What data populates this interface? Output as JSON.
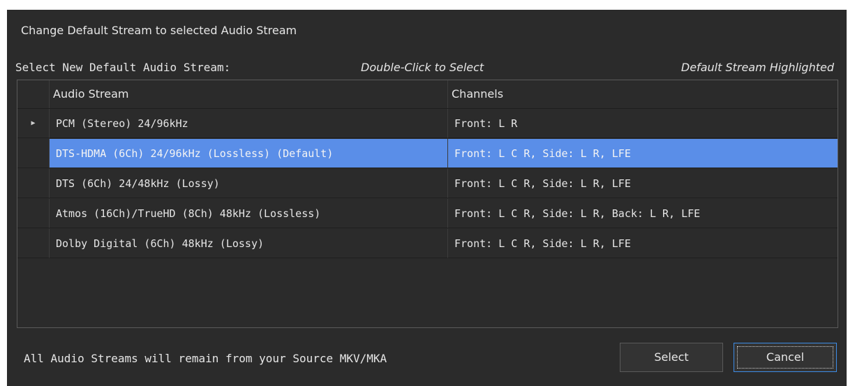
{
  "dialog": {
    "title": "Change Default Stream to selected Audio Stream",
    "select_label": "Select New Default Audio Stream:",
    "hint_double_click": "Double-Click to Select",
    "hint_default_highlighted": "Default Stream Highlighted",
    "footer_text": "All Audio Streams will remain from your Source MKV/MKA",
    "colors": {
      "background": "#2b2b2b",
      "selection": "#5a8ee8",
      "focus_border": "#3c8ce6",
      "text": "#e6e6e6"
    }
  },
  "grid": {
    "columns": [
      "Audio Stream",
      "Channels"
    ],
    "current_row_icon": "triangle-right-icon",
    "rows": [
      {
        "stream": "PCM (Stereo) 24/96kHz",
        "channels": "Front: L R",
        "current": true,
        "selected": false
      },
      {
        "stream": "DTS-HDMA (6Ch) 24/96kHz (Lossless) (Default)",
        "channels": "Front: L C R, Side: L R, LFE",
        "current": false,
        "selected": true
      },
      {
        "stream": "DTS (6Ch) 24/48kHz (Lossy)",
        "channels": "Front: L C R, Side: L R, LFE",
        "current": false,
        "selected": false
      },
      {
        "stream": "Atmos (16Ch)/TrueHD (8Ch) 48kHz (Lossless)",
        "channels": "Front: L C R, Side: L R, Back: L R, LFE",
        "current": false,
        "selected": false
      },
      {
        "stream": "Dolby Digital (6Ch) 48kHz (Lossy)",
        "channels": "Front: L C R, Side: L R, LFE",
        "current": false,
        "selected": false
      }
    ]
  },
  "buttons": {
    "select_label": "Select",
    "cancel_label": "Cancel"
  }
}
